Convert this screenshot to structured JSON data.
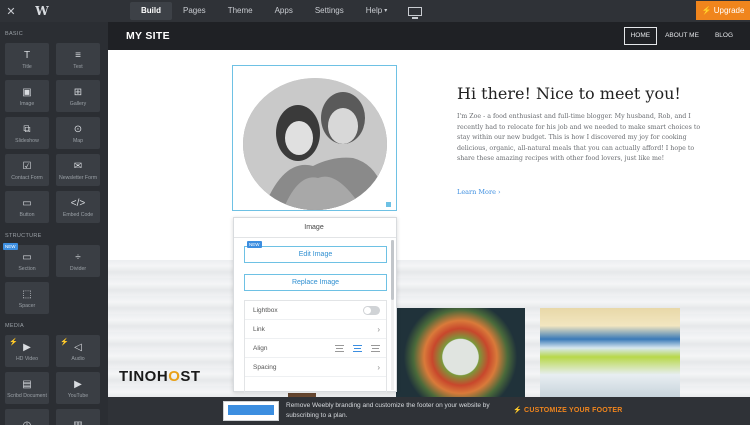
{
  "topbar": {
    "close_icon": "close-icon",
    "logo": "W",
    "nav": [
      {
        "label": "Build",
        "active": true
      },
      {
        "label": "Pages",
        "active": false
      },
      {
        "label": "Theme",
        "active": false
      },
      {
        "label": "Apps",
        "active": false
      },
      {
        "label": "Settings",
        "active": false
      },
      {
        "label": "Help",
        "active": false,
        "dropdown": true
      }
    ],
    "device_icon": "monitor-icon",
    "upgrade_label": "⚡ Upgrade",
    "upgrade_color": "#f0851d"
  },
  "sidebar": {
    "sections": [
      {
        "title": "BASIC"
      },
      {
        "title": "STRUCTURE"
      },
      {
        "title": "MEDIA"
      }
    ],
    "new_badge": "NEW",
    "basic": [
      {
        "label": "Title",
        "icon": "T"
      },
      {
        "label": "Text",
        "icon": "≡"
      },
      {
        "label": "Image",
        "icon": "▣"
      },
      {
        "label": "Gallery",
        "icon": "⊞"
      },
      {
        "label": "Slideshow",
        "icon": "⧉"
      },
      {
        "label": "Map",
        "icon": "⊙"
      },
      {
        "label": "Contact Form",
        "icon": "☑"
      },
      {
        "label": "Newsletter Form",
        "icon": "✉"
      },
      {
        "label": "Button",
        "icon": "▭"
      },
      {
        "label": "Embed Code",
        "icon": "</>"
      }
    ],
    "structure": [
      {
        "label": "Section",
        "icon": "▭"
      },
      {
        "label": "Divider",
        "icon": "÷"
      },
      {
        "label": "Spacer",
        "icon": "⬚"
      }
    ],
    "media": [
      {
        "label": "HD Video",
        "icon": "▶"
      },
      {
        "label": "Audio",
        "icon": "◁"
      },
      {
        "label": "Scribd Document",
        "icon": "▤"
      },
      {
        "label": "YouTube",
        "icon": "▶"
      },
      {
        "label": "",
        "icon": "◷"
      },
      {
        "label": "",
        "icon": "▥"
      }
    ]
  },
  "site": {
    "title": "MY SITE",
    "nav": [
      {
        "label": "HOME",
        "active": true
      },
      {
        "label": "ABOUT ME",
        "active": false
      },
      {
        "label": "BLOG",
        "active": false
      }
    ],
    "hero_title": "Hi there! Nice to meet you!",
    "hero_body": "I'm Zoe - a food enthusiast and full-time blogger. My husband, Rob, and I recently had to relocate for his job and we needed to make smart choices to stay within our new budget. This is how I discovered my joy for cooking delicious, organic, all-natural meals that you can actually afford! I hope to share these amazing recipes with other food lovers, just like me!",
    "learn_more": "Learn More ›"
  },
  "image_panel": {
    "title": "Image",
    "new_badge": "NEW",
    "edit_label": "Edit Image",
    "replace_label": "Replace Image",
    "options": {
      "lightbox": "Lightbox",
      "link": "Link",
      "align": "Align",
      "spacing": "Spacing"
    }
  },
  "footer": {
    "text": "Remove Weebly branding and customize the footer on your website by subscribing to a plan.",
    "cta": "⚡ CUSTOMIZE YOUR FOOTER"
  },
  "watermark": {
    "part1": "TINO",
    "part2": "H",
    "part3": "O",
    "part4": "ST"
  }
}
